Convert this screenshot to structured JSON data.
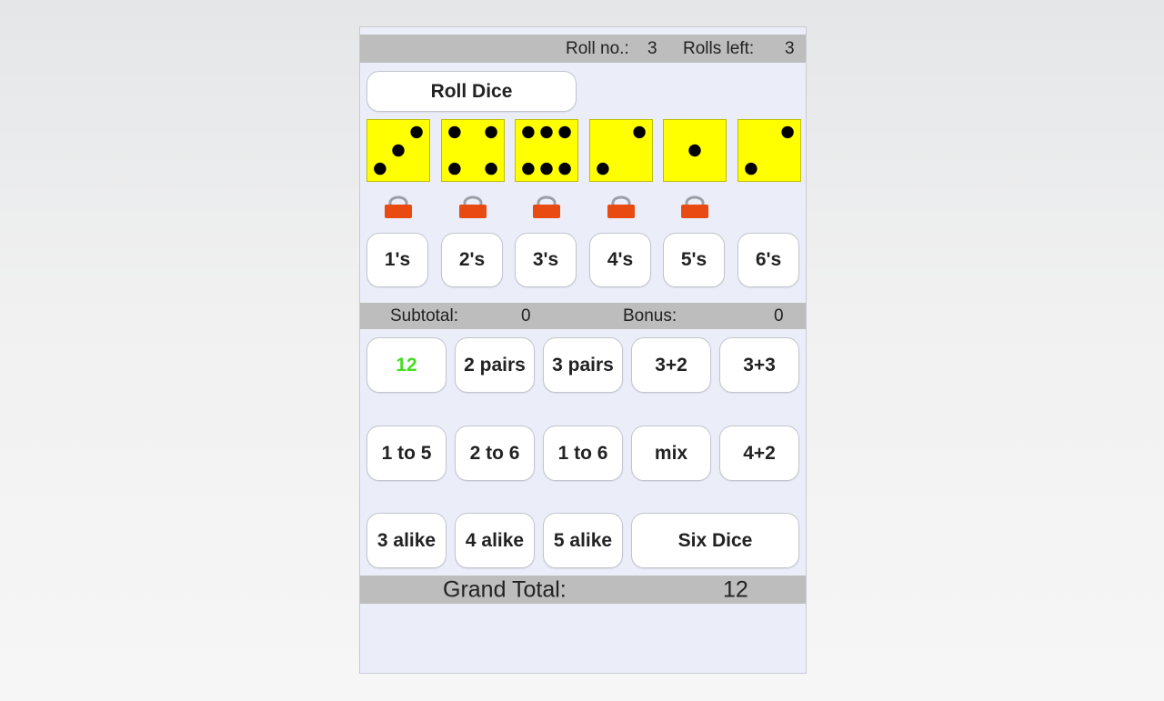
{
  "status": {
    "roll_no_label": "Roll no.:",
    "roll_no_value": "3",
    "rolls_left_label": "Rolls left:",
    "rolls_left_value": "3"
  },
  "roll_button_label": "Roll Dice",
  "dice": [
    {
      "value": 3,
      "locked": true
    },
    {
      "value": 4,
      "locked": true
    },
    {
      "value": 6,
      "locked": true
    },
    {
      "value": 2,
      "locked": true
    },
    {
      "value": 1,
      "locked": true
    },
    {
      "value": 2,
      "locked": false
    }
  ],
  "dice_color": "#ffff00",
  "lock_color": "#e84a12",
  "upper_buttons": [
    "1's",
    "2's",
    "3's",
    "4's",
    "5's",
    "6's"
  ],
  "subtotal": {
    "label": "Subtotal:",
    "value": "0",
    "bonus_label": "Bonus:",
    "bonus_value": "0"
  },
  "combo_rows": [
    [
      "12",
      "2 pairs",
      "3 pairs",
      "3+2",
      "3+3"
    ],
    [
      "1 to 5",
      "2 to 6",
      "1 to 6",
      "mix",
      "4+2"
    ],
    [
      "3 alike",
      "4 alike",
      "5 alike",
      "Six Dice"
    ]
  ],
  "scored_color": "#44dd22",
  "grand_total": {
    "label": "Grand Total:",
    "value": "12"
  }
}
